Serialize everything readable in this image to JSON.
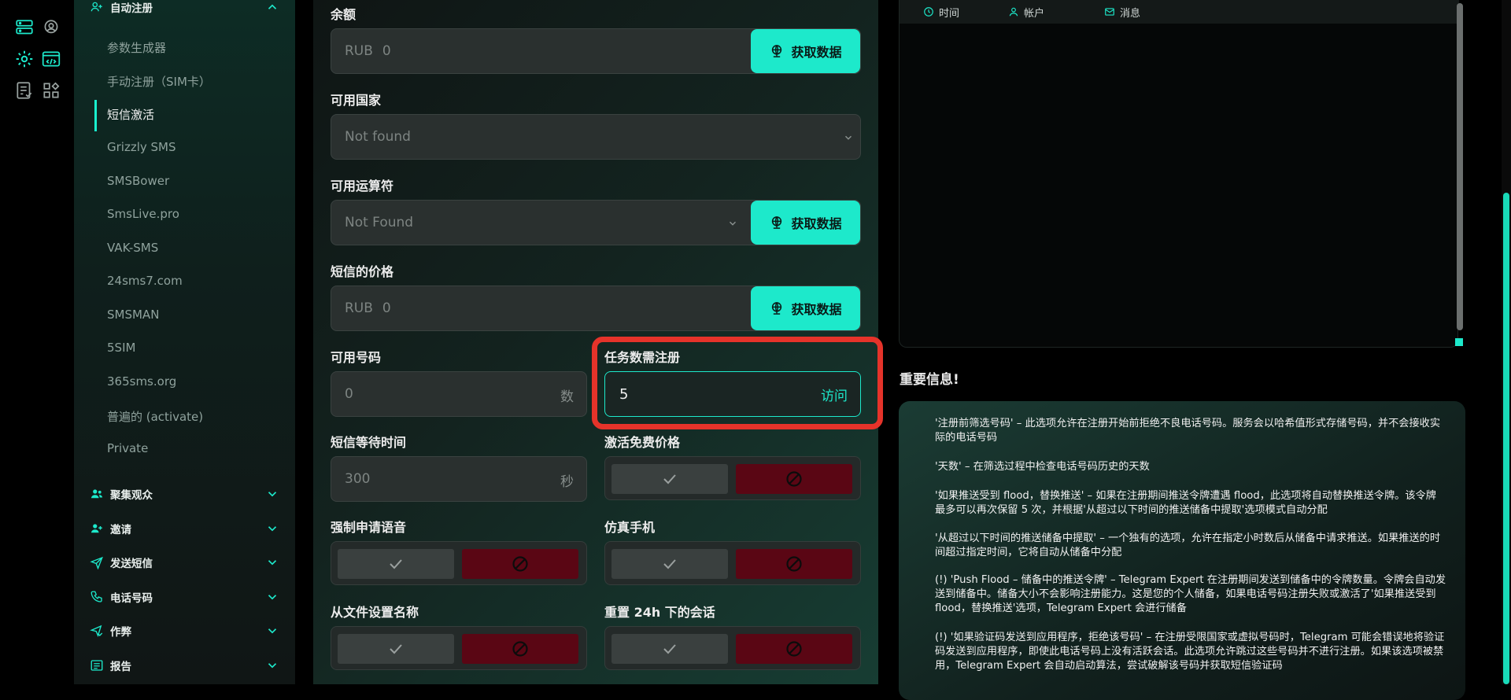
{
  "nav": {
    "auto_register": {
      "label": "自动注册"
    },
    "sub_items": [
      {
        "label": "参数生成器"
      },
      {
        "label": "手动注册（SIM卡）"
      },
      {
        "label": "短信激活"
      },
      {
        "label": "Grizzly SMS"
      },
      {
        "label": "SMSBower"
      },
      {
        "label": "SmsLive.pro"
      },
      {
        "label": "VAK-SMS"
      },
      {
        "label": "24sms7.com"
      },
      {
        "label": "SMSMAN"
      },
      {
        "label": "5SIM"
      },
      {
        "label": "365sms.org"
      },
      {
        "label": "普遍的 (activate)"
      },
      {
        "label": "Private"
      }
    ],
    "groups": [
      {
        "label": "聚集观众"
      },
      {
        "label": "邀请"
      },
      {
        "label": "发送短信"
      },
      {
        "label": "电话号码"
      },
      {
        "label": "作弊"
      },
      {
        "label": "报告"
      }
    ]
  },
  "form": {
    "balance": {
      "label": "余额",
      "currency": "RUB",
      "value": "0"
    },
    "fetch_button": "获取数据",
    "countries": {
      "label": "可用国家",
      "value": "Not found"
    },
    "operators": {
      "label": "可用运算符",
      "value": "Not Found"
    },
    "sms_price": {
      "label": "短信的价格",
      "currency": "RUB",
      "value": "0"
    },
    "available_numbers": {
      "label": "可用号码",
      "value": "0",
      "suffix": "数"
    },
    "tasks": {
      "label": "任务数需注册",
      "value": "5",
      "action": "访问"
    },
    "sms_wait": {
      "label": "短信等待时间",
      "value": "300",
      "suffix": "秒"
    },
    "free_activation_price": {
      "label": "激活免费价格"
    },
    "force_voice": {
      "label": "强制申请语音"
    },
    "emulate_phone": {
      "label": "仿真手机"
    },
    "name_from_file": {
      "label": "从文件设置名称"
    },
    "reset_24h": {
      "label": "重置 24h 下的会话"
    }
  },
  "log": {
    "col_time": "时间",
    "col_account": "帐户",
    "col_message": "消息"
  },
  "important": {
    "title": "重要信息!",
    "paragraphs": [
      "'注册前筛选号码' – 此选项允许在注册开始前拒绝不良电话号码。服务会以哈希值形式存储号码，并不会接收实际的电话号码",
      "'天数' – 在筛选过程中检查电话号码历史的天数",
      "'如果推送受到 flood，替换推送' – 如果在注册期间推送令牌遭遇 flood，此选项将自动替换推送令牌。该令牌最多可以再次保留 5 次，并根据'从超过以下时间的推送储备中提取'选项模式自动分配",
      "'从超过以下时间的推送储备中提取' – 一个独有的选项，允许在指定小时数后从储备中请求推送。如果推送的时间超过指定时间，它将自动从储备中分配",
      "(!) 'Push Flood – 储备中的推送令牌' – Telegram Expert 在注册期间发送到储备中的令牌数量。令牌会自动发送到储备中。储备大小不会影响注册能力。这是您的个人储备，如果电话号码注册失败或激活了'如果推送受到 flood，替换推送'选项，Telegram Expert 会进行储备",
      "(!) '如果验证码发送到应用程序，拒绝该号码' – 在注册受限国家或虚拟号码时，Telegram 可能会错误地将验证码发送到应用程序，即使此电话号码上没有活跃会话。此选项允许跳过这些号码并不进行注册。如果该选项被禁用，Telegram Expert 会自动启动算法，尝试破解该号码并获取短信验证码"
    ]
  },
  "colors": {
    "accent": "#1de9cb",
    "danger": "#5a0614",
    "highlight": "#e5332a"
  }
}
